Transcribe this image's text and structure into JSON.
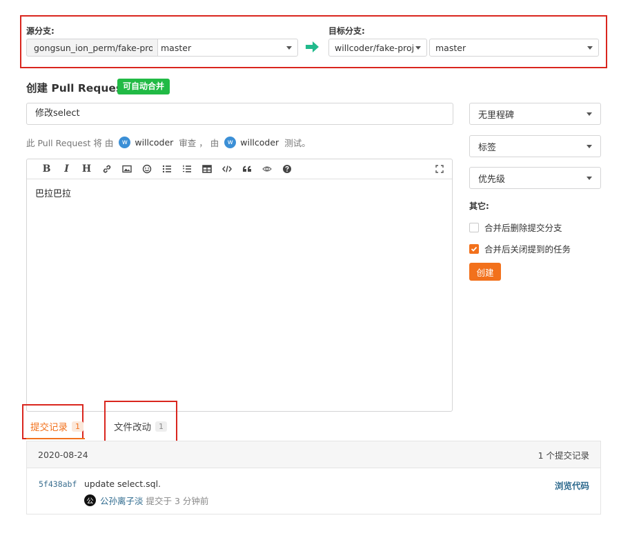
{
  "branches": {
    "source_label": "源分支:",
    "source_repo": "gongsun_ion_perm/fake-project",
    "source_branch": "master",
    "target_label": "目标分支:",
    "target_repo": "willcoder/fake-project",
    "target_branch": "master"
  },
  "header": {
    "title": "创建 Pull Request",
    "merge_badge": "可自动合并"
  },
  "form": {
    "title_value": "修改select",
    "review_prefix": "此 Pull Request 将 由",
    "reviewer_avatar": "w",
    "reviewer": "willcoder",
    "review_mid": "审查 ， 由",
    "tester_avatar": "w",
    "tester": "willcoder",
    "review_suffix": "测试。",
    "body_text": "巴拉巴拉"
  },
  "toolbar": {
    "bold": "B",
    "italic": "I",
    "heading": "H"
  },
  "sidebar": {
    "milestone": "无里程碑",
    "labels": "标签",
    "priority": "优先级",
    "other_label": "其它:",
    "option_delete_branch": "合并后删除提交分支",
    "option_close_issues": "合并后关闭提到的任务",
    "delete_branch_checked": false,
    "close_issues_checked": true,
    "create_button": "创建"
  },
  "tabs": [
    {
      "label": "提交记录",
      "count": "1"
    },
    {
      "label": "文件改动",
      "count": "1"
    }
  ],
  "commits": {
    "date": "2020-08-24",
    "summary": "1 个提交记录",
    "items": [
      {
        "sha": "5f438abf",
        "message": "update select.sql.",
        "author_avatar": "公",
        "author": "公孙离子淡",
        "time": "提交于 3 分钟前",
        "browse_label": "浏览代码"
      }
    ]
  },
  "colors": {
    "accent": "#f2711c",
    "success": "#21ba45",
    "highlight": "#d9251d",
    "link": "#2e6a8e"
  }
}
